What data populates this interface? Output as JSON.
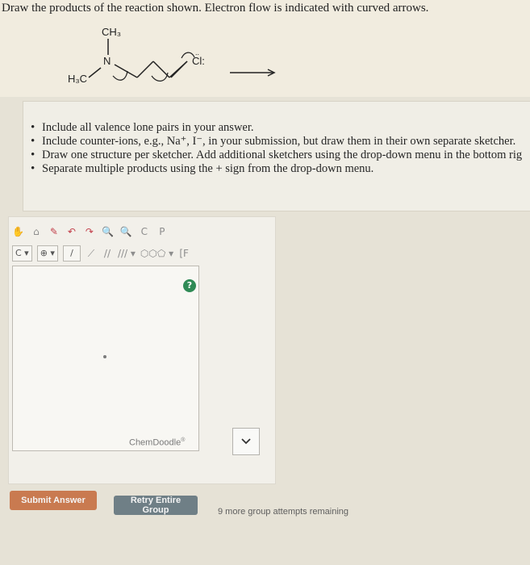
{
  "question": {
    "prompt": "Draw the products of the reaction shown. Electron flow is indicated with curved arrows."
  },
  "molecule": {
    "ch3_top": "CH₃",
    "n_label": "N",
    "h3c_label": "H₃C",
    "cl_label": "Cl:",
    "cl_dots": ".."
  },
  "instructions": {
    "items": [
      "Include all valence lone pairs in your answer.",
      "Include counter-ions, e.g., Na⁺, I⁻, in your submission, but draw them in their own separate sketcher.",
      "Draw one structure per sketcher. Add additional sketchers using the drop-down menu in the bottom rig",
      "Separate multiple products using the + sign from the drop-down menu."
    ]
  },
  "sketcher": {
    "toolbar_row1": [
      {
        "icon": "hand-icon",
        "glyph": "✋",
        "tone": "gray"
      },
      {
        "icon": "lasso-icon",
        "glyph": "⌂",
        "tone": "gray"
      },
      {
        "icon": "eraser-icon",
        "glyph": "✎",
        "tone": "red"
      },
      {
        "icon": "undo-icon",
        "glyph": "↶",
        "tone": "red"
      },
      {
        "icon": "redo-icon",
        "glyph": "↷",
        "tone": "red"
      },
      {
        "icon": "zoom-in-icon",
        "glyph": "🔍",
        "tone": "blue"
      },
      {
        "icon": "zoom-out-icon",
        "glyph": "🔍",
        "tone": "blue"
      },
      {
        "icon": "clear-icon",
        "glyph": "C",
        "tone": "gray"
      },
      {
        "icon": "periodic-table-icon",
        "glyph": "P",
        "tone": "gray"
      }
    ],
    "toolbar_row2": [
      {
        "icon": "carbon-dropdown-icon",
        "glyph": "C ▾",
        "tone": "gray"
      },
      {
        "icon": "charge-plus-icon",
        "glyph": "⊕ ▾",
        "tone": "gray"
      },
      {
        "icon": "single-bond-icon",
        "glyph": "/",
        "tone": "gray"
      },
      {
        "icon": "wedge-bond-icon",
        "glyph": "⟋",
        "tone": "gray"
      },
      {
        "icon": "double-bond-icon",
        "glyph": "//",
        "tone": "gray"
      },
      {
        "icon": "triple-bond-icon",
        "glyph": "/// ▾",
        "tone": "gray"
      },
      {
        "icon": "ring-icon",
        "glyph": "⬡⬡⬠ ▾",
        "tone": "gray"
      },
      {
        "icon": "templates-icon",
        "glyph": "[F",
        "tone": "gray"
      }
    ],
    "help_label": "?",
    "brand": "ChemDoodle",
    "brand_mark": "®"
  },
  "actions": {
    "submit_label": "Submit Answer",
    "retry_label": "Retry Entire Group",
    "attempts_text": "9 more group attempts remaining"
  },
  "colors": {
    "background": "#e6e2d6",
    "submit": "#c97a50",
    "retry": "#6f7f86",
    "help": "#2f8a55"
  }
}
